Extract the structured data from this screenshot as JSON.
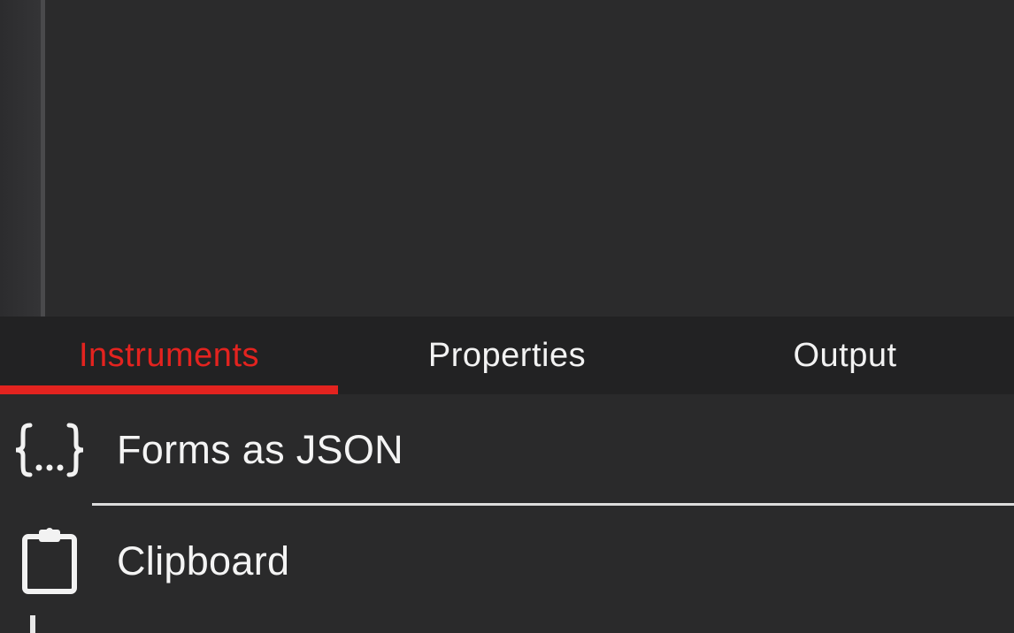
{
  "tabs": [
    {
      "label": "Instruments",
      "active": true
    },
    {
      "label": "Properties",
      "active": false
    },
    {
      "label": "Output",
      "active": false
    }
  ],
  "list": {
    "items": [
      {
        "label": "Forms as JSON",
        "icon": "json-braces-icon"
      },
      {
        "label": "Clipboard",
        "icon": "clipboard-icon"
      }
    ]
  },
  "colors": {
    "accent": "#e3231f",
    "background": "#2a2a2b",
    "tabbar": "#222223",
    "text": "#f2f2f2"
  }
}
